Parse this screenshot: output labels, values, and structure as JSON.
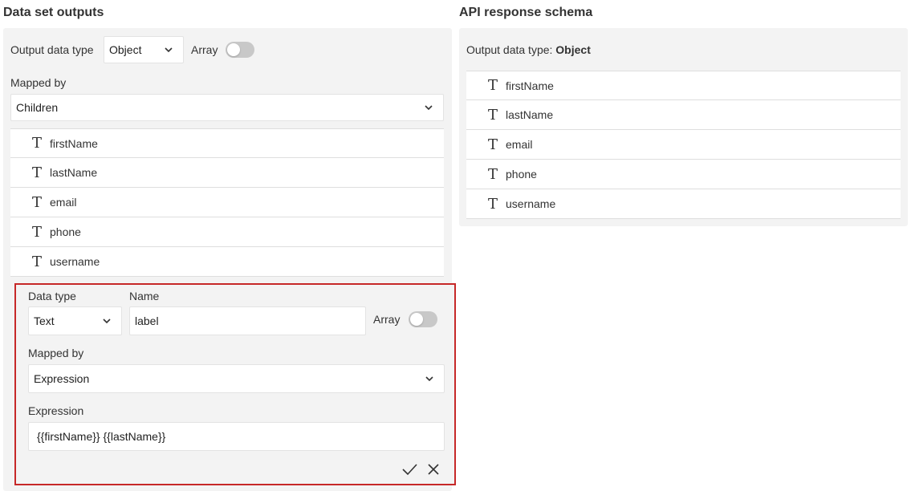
{
  "left": {
    "title": "Data set outputs",
    "output_type_label": "Output data type",
    "output_type_value": "Object",
    "array_label": "Array",
    "mapped_by_label": "Mapped by",
    "mapped_by_value": "Children",
    "fields": [
      {
        "type_icon": "T",
        "name": "firstName"
      },
      {
        "type_icon": "T",
        "name": "lastName"
      },
      {
        "type_icon": "T",
        "name": "email"
      },
      {
        "type_icon": "T",
        "name": "phone"
      },
      {
        "type_icon": "T",
        "name": "username"
      }
    ],
    "editor": {
      "data_type_label": "Data type",
      "data_type_value": "Text",
      "name_label": "Name",
      "name_value": "label",
      "array_label": "Array",
      "mapped_by_label": "Mapped by",
      "mapped_by_value": "Expression",
      "expression_label": "Expression",
      "expression_value": "{{firstName}} {{lastName}}"
    }
  },
  "right": {
    "title": "API response schema",
    "output_type_label": "Output data type: ",
    "output_type_value": "Object",
    "fields": [
      {
        "type_icon": "T",
        "name": "firstName"
      },
      {
        "type_icon": "T",
        "name": "lastName"
      },
      {
        "type_icon": "T",
        "name": "email"
      },
      {
        "type_icon": "T",
        "name": "phone"
      },
      {
        "type_icon": "T",
        "name": "username"
      }
    ]
  },
  "colors": {
    "panel_bg": "#f3f3f3",
    "editor_border": "#c62828",
    "toggle_off": "#c8c8c8"
  }
}
